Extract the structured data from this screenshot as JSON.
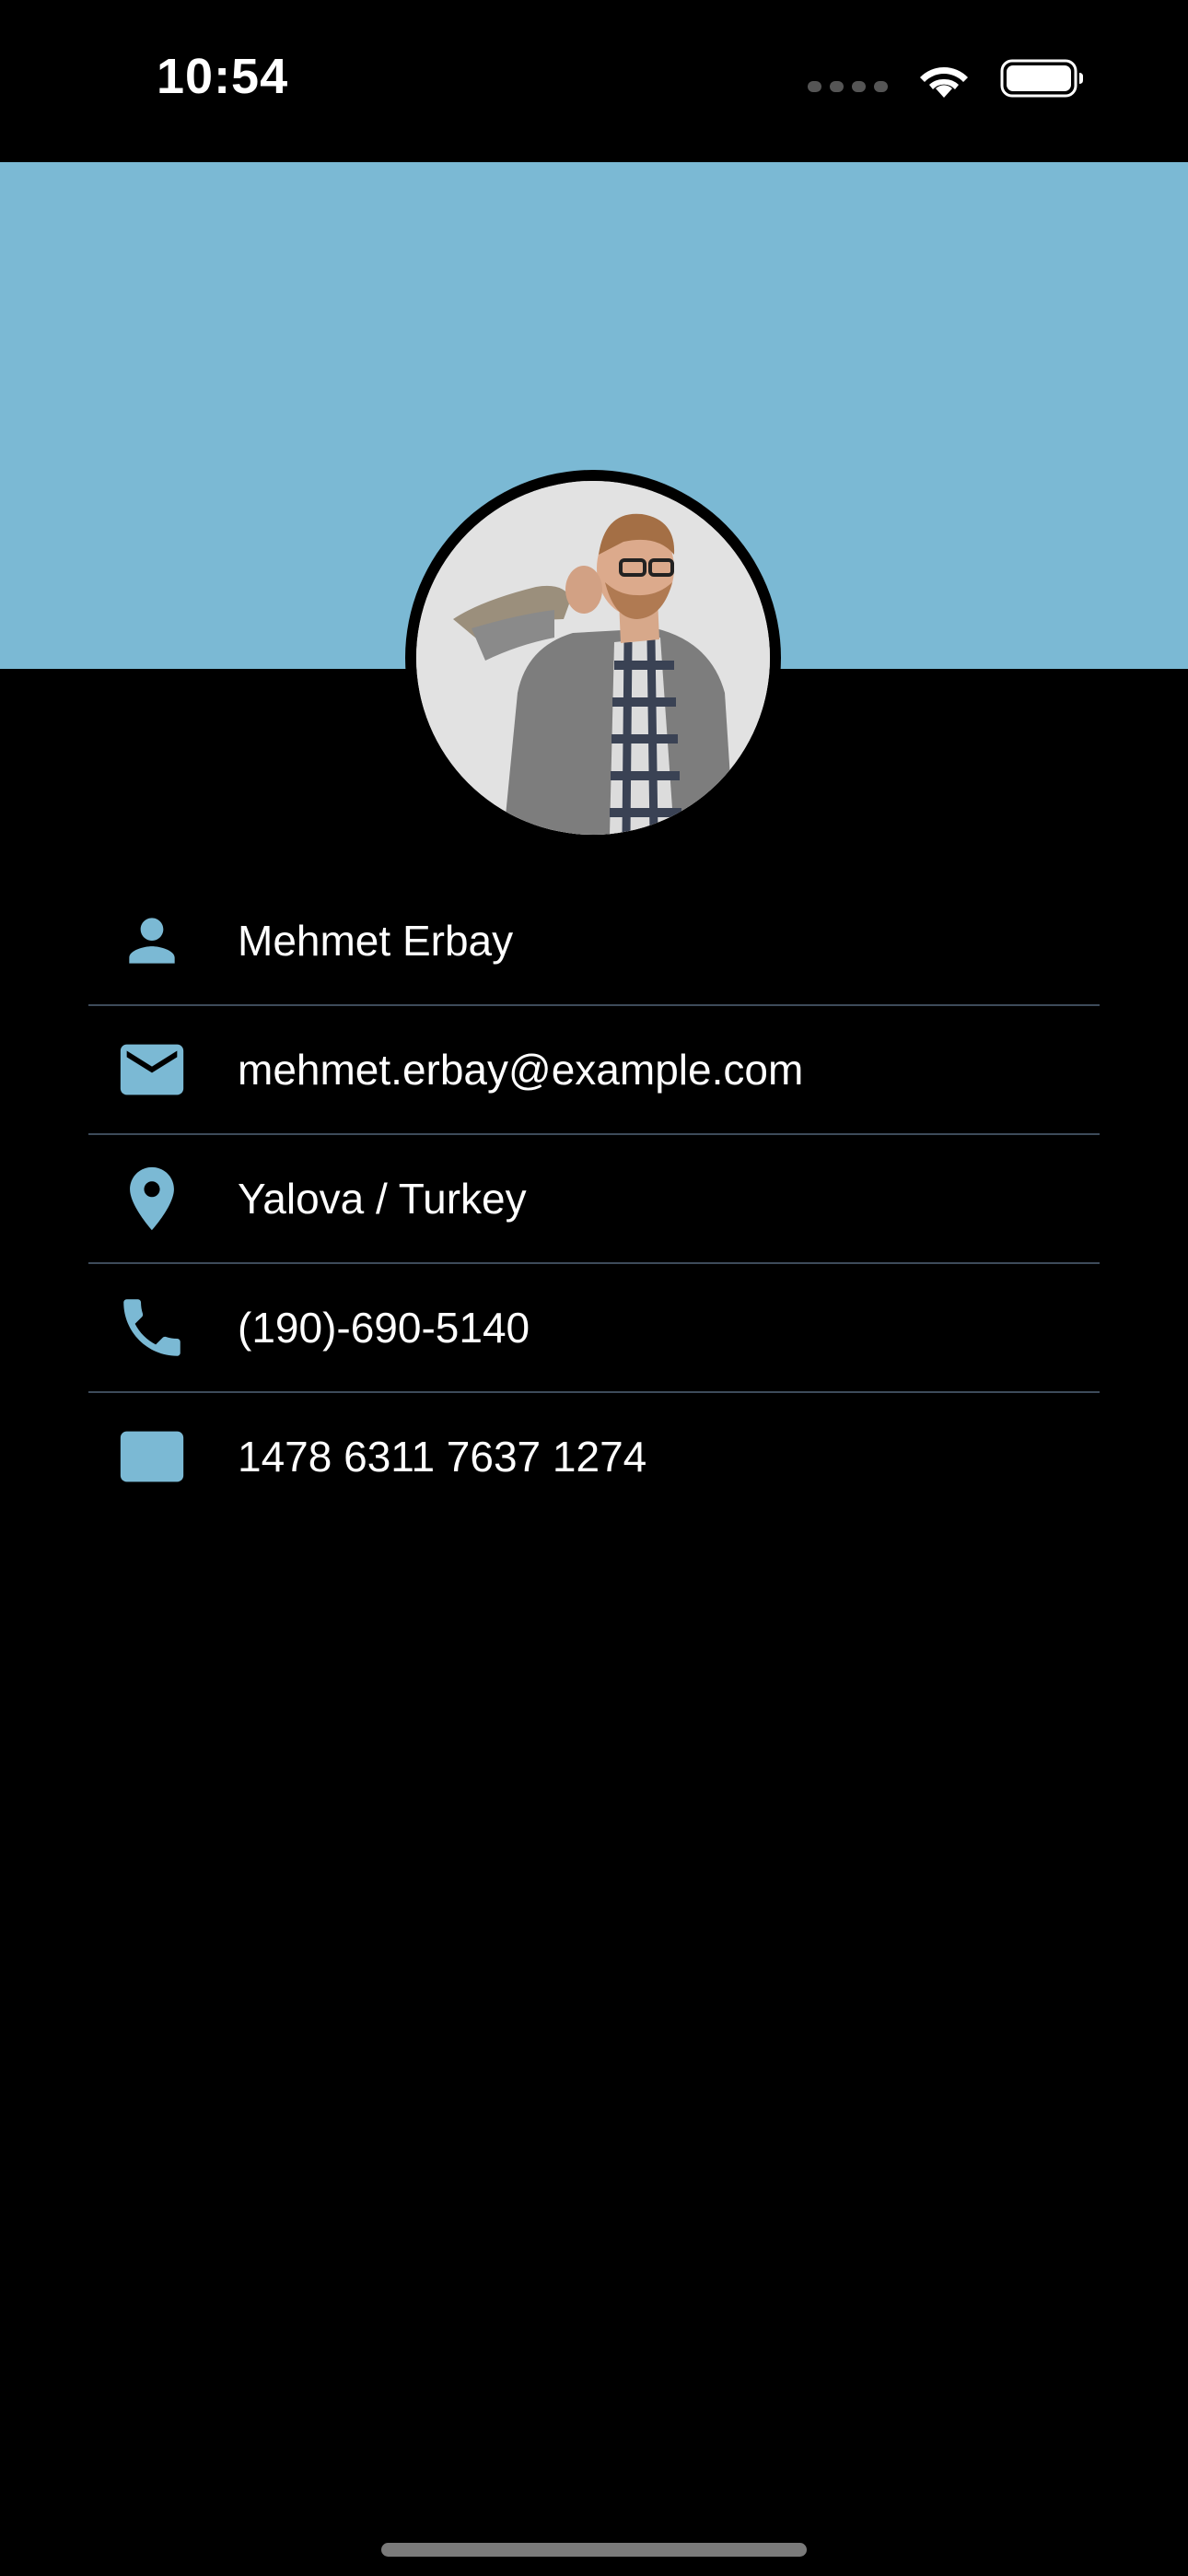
{
  "status_bar": {
    "time": "10:54",
    "icons": [
      "cellular-signal-icon",
      "wifi-icon",
      "battery-icon"
    ]
  },
  "theme": {
    "accent": "#7bb9d4",
    "background": "#000000",
    "text": "#ffffff",
    "divider": "#3d4b5a"
  },
  "profile": {
    "avatar": "profile-photo",
    "items": [
      {
        "icon": "person-icon",
        "value": "Mehmet Erbay"
      },
      {
        "icon": "mail-icon",
        "value": "mehmet.erbay@example.com"
      },
      {
        "icon": "location-pin-icon",
        "value": "Yalova / Turkey"
      },
      {
        "icon": "phone-icon",
        "value": "(190)-690-5140"
      },
      {
        "icon": "id-card-icon",
        "value": "1478 6311 7637 1274"
      }
    ]
  }
}
